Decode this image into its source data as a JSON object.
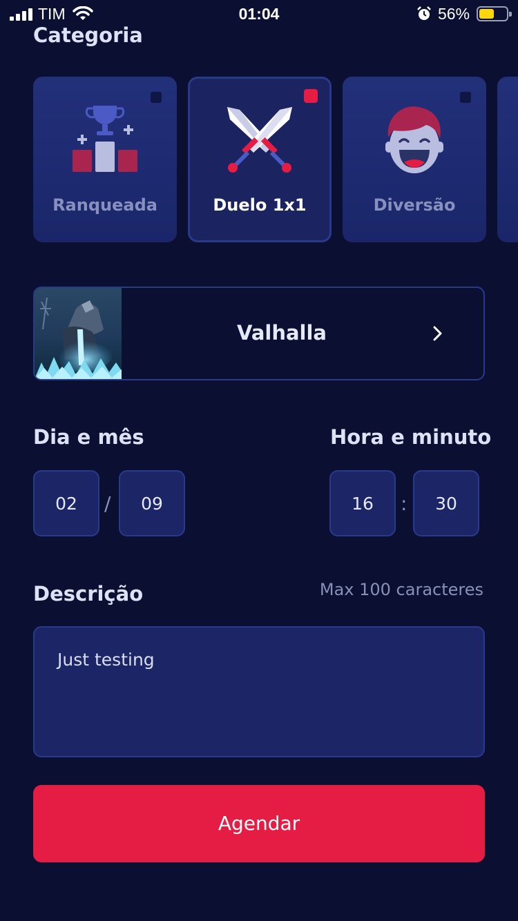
{
  "status_bar": {
    "carrier": "TIM",
    "time": "01:04",
    "battery_percent": "56%",
    "battery_level": 0.56,
    "icons": [
      "signal-icon",
      "wifi-icon",
      "alarm-icon",
      "battery-icon"
    ]
  },
  "category": {
    "heading": "Categoria",
    "items": [
      {
        "label": "Ranqueada",
        "icon": "trophy-podium-icon",
        "selected": false
      },
      {
        "label": "Duelo 1x1",
        "icon": "crossed-swords-icon",
        "selected": true
      },
      {
        "label": "Diversão",
        "icon": "laughing-face-icon",
        "selected": false
      }
    ]
  },
  "guild": {
    "name": "Valhalla",
    "icon": "chevron-right-icon"
  },
  "date": {
    "label": "Dia e mês",
    "day": "02",
    "separator": "/",
    "month": "09"
  },
  "time": {
    "label": "Hora e minuto",
    "hour": "16",
    "separator": ":",
    "minute": "30"
  },
  "description": {
    "label": "Descrição",
    "limit_text": "Max 100 caracteres",
    "value": "Just testing"
  },
  "submit": {
    "label": "Agendar"
  },
  "colors": {
    "background": "#0b1033",
    "card": "#1c2565",
    "border": "#2a3a8a",
    "accent": "#e51c44"
  }
}
